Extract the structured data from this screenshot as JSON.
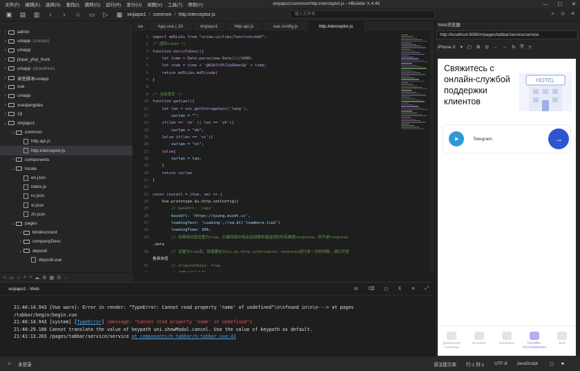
{
  "menu": {
    "items": [
      "文件(F)",
      "编辑(E)",
      "选择(S)",
      "查找(I)",
      "跳转(G)",
      "运行(R)",
      "发行(U)",
      "视图(V)",
      "工具(T)",
      "帮助(Y)"
    ],
    "window_title": "xinjiapo1/common/http.interceptor.js - HBuilder X 4.45"
  },
  "toolbar": {
    "breadcrumb": [
      "xinjiapo1",
      "common",
      "http.interceptor.js"
    ],
    "search_placeholder": "输入文件名"
  },
  "tree": [
    {
      "label": "admin",
      "sub": "",
      "depth": 0,
      "caret": "›",
      "type": "folder"
    },
    {
      "label": "uniapp",
      "sub": "(master)",
      "depth": 0,
      "caret": "›",
      "type": "folder"
    },
    {
      "label": "uniapp",
      "sub": "",
      "depth": 0,
      "caret": "›",
      "type": "folder"
    },
    {
      "label": "jinpai_yhyl_front",
      "sub": "",
      "depth": 0,
      "caret": "›",
      "type": "folder"
    },
    {
      "label": "uniapp",
      "sub": "(drawkline)",
      "depth": 0,
      "caret": "›",
      "type": "folder"
    },
    {
      "label": "单些脚本uniapp",
      "sub": "",
      "depth": 0,
      "caret": "›",
      "type": "folder"
    },
    {
      "label": "vue",
      "sub": "",
      "depth": 0,
      "caret": "›",
      "type": "folder"
    },
    {
      "label": "uniapp",
      "sub": "",
      "depth": 0,
      "caret": "›",
      "type": "folder"
    },
    {
      "label": "vueqiangdan",
      "sub": "",
      "depth": 0,
      "caret": "›",
      "type": "folder"
    },
    {
      "label": "19",
      "sub": "",
      "depth": 0,
      "caret": "›",
      "type": "folder"
    },
    {
      "label": "xinjiapo1",
      "sub": "",
      "depth": 0,
      "caret": "⌄",
      "type": "folder"
    },
    {
      "label": "common",
      "sub": "",
      "depth": 1,
      "caret": "⌄",
      "type": "folder"
    },
    {
      "label": "http.api.js",
      "sub": "",
      "depth": 2,
      "caret": "",
      "type": "file"
    },
    {
      "label": "http.interceptor.js",
      "sub": "",
      "depth": 2,
      "caret": "",
      "type": "file",
      "selected": true
    },
    {
      "label": "components",
      "sub": "",
      "depth": 1,
      "caret": "›",
      "type": "folder"
    },
    {
      "label": "locale",
      "sub": "",
      "depth": 1,
      "caret": "⌄",
      "type": "folder"
    },
    {
      "label": "en.json",
      "sub": "",
      "depth": 2,
      "caret": "",
      "type": "file"
    },
    {
      "label": "index.js",
      "sub": "",
      "depth": 2,
      "caret": "",
      "type": "file"
    },
    {
      "label": "ru.json",
      "sub": "",
      "depth": 2,
      "caret": "",
      "type": "file"
    },
    {
      "label": "vi.json",
      "sub": "",
      "depth": 2,
      "caret": "",
      "type": "file"
    },
    {
      "label": "zh.json",
      "sub": "",
      "depth": 2,
      "caret": "",
      "type": "file"
    },
    {
      "label": "pages",
      "sub": "",
      "depth": 1,
      "caret": "⌄",
      "type": "folder"
    },
    {
      "label": "bindAccount",
      "sub": "",
      "depth": 2,
      "caret": "›",
      "type": "folder"
    },
    {
      "label": "companyDesc",
      "sub": "",
      "depth": 2,
      "caret": "›",
      "type": "folder"
    },
    {
      "label": "deposit",
      "sub": "",
      "depth": 2,
      "caret": "⌄",
      "type": "folder"
    },
    {
      "label": "deposit.vue",
      "sub": "",
      "depth": 3,
      "caret": "",
      "type": "file"
    }
  ],
  "tabs": [
    {
      "label": "ue",
      "active": false
    },
    {
      "label": "App.vue | 19",
      "active": false
    },
    {
      "label": "xinjiapo1",
      "active": false
    },
    {
      "label": "http.api.js",
      "active": false
    },
    {
      "label": "vue.config.js",
      "active": false
    },
    {
      "label": "http.interceptor.js",
      "active": true
    }
  ],
  "code": [
    {
      "n": "1",
      "t": "import md5Libs from \"uview-ui/libs/function/md5\";"
    },
    {
      "n": "2",
      "t": "/* 国际token */"
    },
    {
      "n": "3",
      "t": "function encryToken(){"
    },
    {
      "n": "4",
      "t": "    let time = Date.parse(new Date())/1000;"
    },
    {
      "n": "5",
      "t": "    let code = time + '@62b7c5572a99ee1@' + time;"
    },
    {
      "n": "6",
      "t": "    return md5Libs.md5(code)"
    },
    {
      "n": "7",
      "t": "}"
    },
    {
      "n": "8",
      "t": ""
    },
    {
      "n": "9",
      "t": "/* 当前语言 */"
    },
    {
      "n": "10",
      "t": "function getLan(){"
    },
    {
      "n": "11",
      "t": "    let lan = uni.getStorageSync('lang'),"
    },
    {
      "n": "12",
      "t": "        curlan = \"\";"
    },
    {
      "n": "13",
      "t": "    if(lan == 'zh' || lan == 'zh'){"
    },
    {
      "n": "14",
      "t": "        curlan = \"zh\";"
    },
    {
      "n": "15",
      "t": "    }else if(lan == 'vi'){"
    },
    {
      "n": "16",
      "t": "        curlan = \"vi\";"
    },
    {
      "n": "17",
      "t": "    }else{"
    },
    {
      "n": "18",
      "t": "        curlan = lan;"
    },
    {
      "n": "19",
      "t": "    }"
    },
    {
      "n": "20",
      "t": "    return curlan"
    },
    {
      "n": "21",
      "t": "}"
    },
    {
      "n": "22",
      "t": ""
    },
    {
      "n": "23",
      "t": "const install = (Vue, vm) => {"
    },
    {
      "n": "24",
      "t": "    Vue.prototype.$u.http.setConfig({"
    },
    {
      "n": "25",
      "t": "        // baseUrl: '/api',"
    },
    {
      "n": "26",
      "t": "        baseUrl: 'https://qiang.eusdt.cc',"
    },
    {
      "n": "27",
      "t": "        loadingText: 'Loading',//vm.$t('loadmore.tip2')"
    },
    {
      "n": "28",
      "t": "        loadingTime: 100,"
    },
    {
      "n": "29",
      "t": "        // 如果将此值设置为true，拦截回调中将会返回服务端返回的所有数据response，而不是response"
    },
    {
      "n": "",
      "t": ".data"
    },
    {
      "n": "30",
      "t": "        // 设置为true后，就需要在this.$u.http.interceptor.response进行多一次的判断，请打印查"
    },
    {
      "n": "",
      "t": "看具体值"
    },
    {
      "n": "31",
      "t": "        // originalData: true,"
    },
    {
      "n": "32",
      "t": "        // 设置自定义头部content-type"
    },
    {
      "n": "33",
      "t": "        // header: {"
    },
    {
      "n": "34",
      "t": "        //   'content-type': 'application/json;charset=UTF-8'"
    },
    {
      "n": "35",
      "t": "        // }"
    },
    {
      "n": "36",
      "t": "    });"
    }
  ],
  "console": {
    "tab_label": "xinjiapo1 - Web",
    "lines": [
      {
        "time": "21:40:14.943",
        "parts": [
          {
            "t": " [Vue warn]: Error in render: \"TypeError: Cannot read property 'name' of undefined\"\\n\\nfound in\\n\\n---> at pages",
            "c": ""
          }
        ]
      },
      {
        "time": "",
        "parts": [
          {
            "t": "/tabbar/begin/begin.vue",
            "c": ""
          }
        ]
      },
      {
        "time": "21:40:14.943",
        "parts": [
          {
            "t": " [system] [",
            "c": ""
          },
          {
            "t": "TypeError",
            "c": "link"
          },
          {
            "t": "] ",
            "c": ""
          },
          {
            "t": "{message: \"Cannot read property 'name' of undefined\"}",
            "c": "red"
          }
        ]
      },
      {
        "time": "21:40:29.100",
        "parts": [
          {
            "t": " Cannot translate the value of keypath uni.showModal.cancel. Use the value of keypath as default.",
            "c": ""
          }
        ]
      },
      {
        "time": "21:41:13.203",
        "parts": [
          {
            "t": " /pages/tabbar/service/service ",
            "c": ""
          },
          {
            "t": "at components/h-tabbar/h-tabbar.vue:43",
            "c": "link"
          }
        ]
      }
    ]
  },
  "preview": {
    "title": "Web浏览器",
    "url": "http://localhost:8080/#/pages/tabbar/service/service",
    "device": "iPhone X",
    "headline": "Свяжитесь с онлайн-службой поддержки клиентов",
    "hotel_sign": "HOTEL",
    "telegram_label": "Telegram",
    "tabbar": [
      {
        "label": "Домашняя страница",
        "active": false
      },
      {
        "label": "история",
        "active": false
      },
      {
        "label": "Начинать",
        "active": false
      },
      {
        "label": "Онлайн-обслуживание",
        "active": true
      },
      {
        "label": "мой",
        "active": false
      }
    ]
  },
  "status": {
    "login": "未登录",
    "syntax_hint": "语法提示库",
    "position": "行:1  列:1",
    "encoding": "UTF-8",
    "language": "JavaScript"
  },
  "colors": {
    "accent": "#2f55d4",
    "telegram": "#2d9ad6",
    "error": "#e05252",
    "link": "#4aa3e8"
  }
}
